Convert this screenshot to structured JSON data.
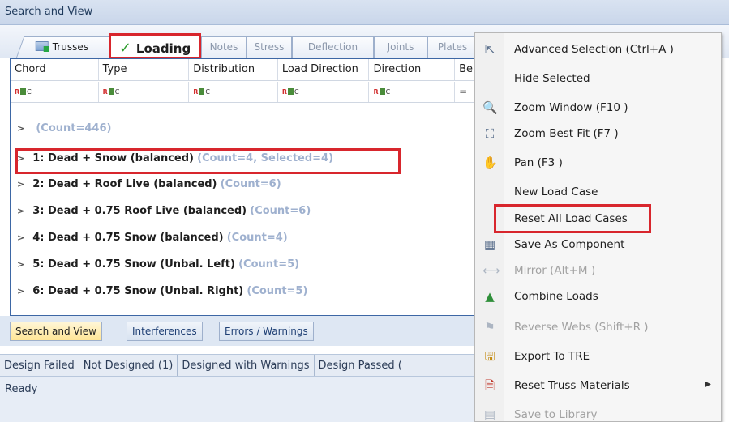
{
  "panel": {
    "title": "Search and View"
  },
  "tabs": [
    {
      "label": "Trusses"
    },
    {
      "label": "Loading",
      "active": true
    },
    {
      "label": "Notes"
    },
    {
      "label": "Stress"
    },
    {
      "label": "Deflection"
    },
    {
      "label": "Joints"
    },
    {
      "label": "Plates"
    }
  ],
  "grid": {
    "columns": [
      "Chord",
      "Type",
      "Distribution",
      "Load Direction",
      "Direction",
      "Be"
    ],
    "filter_glyph": {
      "left": "R",
      "right": "C"
    },
    "filter_eq": "=",
    "groups": [
      {
        "name": "",
        "count": "(Count=446)"
      },
      {
        "name": "1: Dead + Snow (balanced)",
        "count": "(Count=4, Selected=4)"
      },
      {
        "name": "2: Dead + Roof Live (balanced)",
        "count": "(Count=6)"
      },
      {
        "name": "3: Dead + 0.75 Roof Live (balanced)",
        "count": "(Count=6)"
      },
      {
        "name": "4: Dead + 0.75 Snow (balanced)",
        "count": "(Count=4)"
      },
      {
        "name": "5: Dead + 0.75 Snow (Unbal. Left)",
        "count": "(Count=5)"
      },
      {
        "name": "6: Dead + 0.75 Snow (Unbal. Right)",
        "count": "(Count=5)"
      }
    ]
  },
  "lower_tabs": [
    "Search and View",
    "Interferences",
    "Errors / Warnings"
  ],
  "status_tabs": [
    "Design Failed",
    "Not Designed (1)",
    "Designed with Warnings",
    "Design Passed ("
  ],
  "status_text": "Ready",
  "menu": {
    "items": [
      {
        "label": "Advanced Selection (Ctrl+A )",
        "icon": "cursor-icon",
        "disabled": false
      },
      {
        "label": "Hide Selected",
        "icon": "",
        "disabled": false
      },
      {
        "label": "Zoom Window (F10 )",
        "icon": "magnifier-icon",
        "disabled": false
      },
      {
        "label": "Zoom Best Fit (F7 )",
        "icon": "zoom-fit-icon",
        "disabled": false
      },
      {
        "label": "Pan (F3 )",
        "icon": "hand-icon",
        "disabled": false
      },
      {
        "label": "New Load Case",
        "icon": "",
        "disabled": false
      },
      {
        "label": "Reset All Load Cases",
        "icon": "",
        "disabled": false
      },
      {
        "label": "Save As Component",
        "icon": "component-icon",
        "disabled": false
      },
      {
        "label": "Mirror (Alt+M )",
        "icon": "mirror-icon",
        "disabled": true
      },
      {
        "label": "Combine Loads",
        "icon": "combine-icon",
        "disabled": false
      },
      {
        "label": "Reverse Webs (Shift+R )",
        "icon": "reverse-icon",
        "disabled": true
      },
      {
        "label": "Export To TRE",
        "icon": "export-icon",
        "disabled": false
      },
      {
        "label": "Reset Truss Materials",
        "icon": "reset-icon",
        "disabled": false,
        "submenu": true
      },
      {
        "label": "Save to Library",
        "icon": "library-icon",
        "disabled": true
      }
    ]
  },
  "colors": {
    "highlight": "#d8262d",
    "accent": "#3d67a5",
    "count_text": "#9fb1cf"
  }
}
